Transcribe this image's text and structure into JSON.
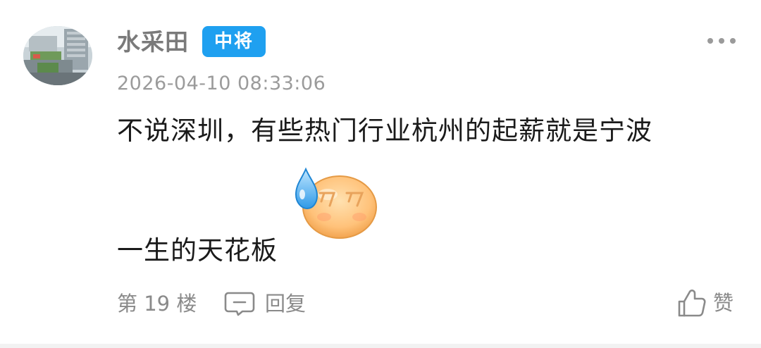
{
  "comment": {
    "username": "水采田",
    "rank_badge": "中将",
    "timestamp": "2026-04-10 08:33:06",
    "content_line1": "不说深圳，有些热门行业杭州的起薪就是宁波",
    "content_line2": "一生的天花板",
    "sticker": "sweat-drop-face-emoji",
    "floor": "第 19 楼",
    "reply_label": "回复",
    "like_label": "赞",
    "icons": {
      "more": "more-dots-icon",
      "reply": "comment-bubble-icon",
      "like": "thumbs-up-icon"
    },
    "colors": {
      "badge": "#1fa0f0",
      "username": "#7a7a7a",
      "meta_text": "#8a8a8a",
      "body_text": "#1a1a1a"
    }
  }
}
